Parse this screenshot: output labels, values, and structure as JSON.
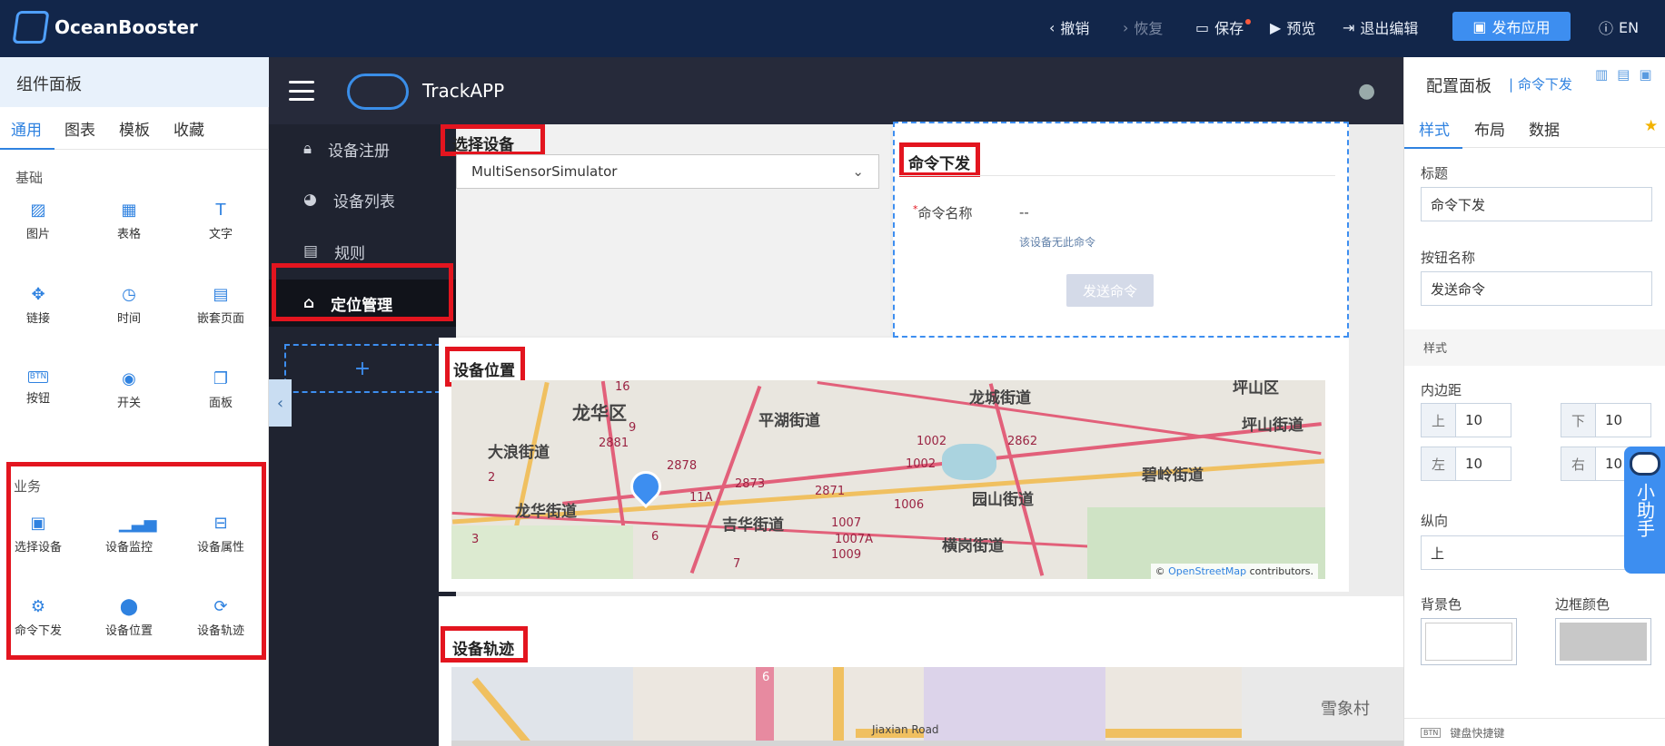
{
  "topbar": {
    "brand": "OceanBooster",
    "undo": "撤销",
    "redo": "恢复",
    "save": "保存",
    "preview": "预览",
    "exit_edit": "退出编辑",
    "publish": "发布应用",
    "lang": "EN"
  },
  "left_panel": {
    "title": "组件面板",
    "tabs": [
      "通用",
      "图表",
      "模板",
      "收藏"
    ],
    "active_tab": "通用",
    "basic_section": "基础",
    "basic_items": [
      "图片",
      "表格",
      "文字",
      "链接",
      "时间",
      "嵌套页面",
      "按钮",
      "开关",
      "面板"
    ],
    "business_section": "业务",
    "business_items": [
      "选择设备",
      "设备监控",
      "设备属性",
      "命令下发",
      "设备位置",
      "设备轨迹"
    ]
  },
  "app": {
    "title": "TrackAPP",
    "nav": [
      "设备注册",
      "设备列表",
      "规则",
      "定位管理"
    ],
    "active_nav": "定位管理",
    "add": "+"
  },
  "select_device": {
    "title": "选择设备",
    "value": "MultiSensorSimulator"
  },
  "command": {
    "title": "命令下发",
    "name_label": "命令名称",
    "name_value": "--",
    "hint": "该设备无此命令",
    "button": "发送命令"
  },
  "location": {
    "title": "设备位置",
    "attribution_prefix": "© ",
    "attribution_link": "OpenStreetMap",
    "attribution_suffix": " contributors.",
    "labels": [
      "龙华区",
      "平湖街道",
      "龙城街道",
      "坪山街道",
      "大浪街道",
      "龙华街道",
      "吉华街道",
      "园山街道",
      "碧岭街道",
      "横岗街道",
      "坪山区"
    ],
    "road_numbers": [
      "16",
      "2881",
      "2878",
      "2873",
      "2871",
      "1002",
      "1002",
      "2862",
      "1006",
      "1007",
      "1007A",
      "1009",
      "11A",
      "9",
      "2",
      "3",
      "6",
      "7"
    ]
  },
  "track": {
    "title": "设备轨迹",
    "labels": [
      "雪象村",
      "Jiaxian Road",
      "6"
    ]
  },
  "right_panel": {
    "title": "配置面板",
    "subtitle": "| 命令下发",
    "tabs": [
      "样式",
      "布局",
      "数据"
    ],
    "active_tab": "样式",
    "title_label": "标题",
    "title_value": "命令下发",
    "button_name_label": "按钮名称",
    "button_name_value": "发送命令",
    "style_section": "样式",
    "padding_label": "内边距",
    "pad_top_k": "上",
    "pad_top_v": "10",
    "pad_bottom_k": "下",
    "pad_bottom_v": "10",
    "pad_left_k": "左",
    "pad_left_v": "10",
    "pad_right_k": "右",
    "pad_right_v": "10",
    "vertical_label": "纵向",
    "vertical_value": "上",
    "bg_color_label": "背景色",
    "border_color_label": "边框颜色",
    "bg_color": "#ffffff",
    "border_color": "#c8c8c8",
    "shortcut_icon": "BTN",
    "shortcut": "键盘快捷键"
  },
  "helper": {
    "label": "小助手"
  },
  "colors": {
    "topbar": "#12264a",
    "accent": "#2f82e0",
    "annotation_red": "#e3151f",
    "app_nav": "#1f2330"
  }
}
